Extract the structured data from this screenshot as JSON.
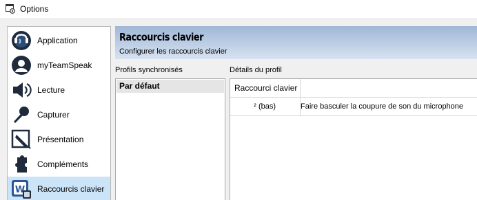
{
  "window": {
    "title": "Options",
    "icon": "gear-window-icon"
  },
  "sidebar": {
    "selected_index": 6,
    "items": [
      {
        "label": "Application",
        "icon": "application-icon"
      },
      {
        "label": "myTeamSpeak",
        "icon": "myteamspeak-icon"
      },
      {
        "label": "Lecture",
        "icon": "speaker-icon"
      },
      {
        "label": "Capturer",
        "icon": "microphone-icon"
      },
      {
        "label": "Présentation",
        "icon": "design-icon"
      },
      {
        "label": "Compléments",
        "icon": "puzzle-icon"
      },
      {
        "label": "Raccourcis clavier",
        "icon": "hotkeys-icon"
      }
    ]
  },
  "header": {
    "title": "Raccourcis clavier",
    "subtitle": "Configurer les raccourcis clavier"
  },
  "profiles": {
    "label": "Profils synchronisés",
    "items": [
      "Par défaut"
    ]
  },
  "details": {
    "label": "Détails du profil",
    "columns": [
      "Raccourci clavier",
      ""
    ],
    "rows": [
      {
        "key": "² (bas)",
        "action": "Faire basculer la coupure de son du microphone"
      }
    ]
  },
  "colors": {
    "selected_bg": "#cce4f7",
    "header_gradient": "#9fb7d6"
  }
}
